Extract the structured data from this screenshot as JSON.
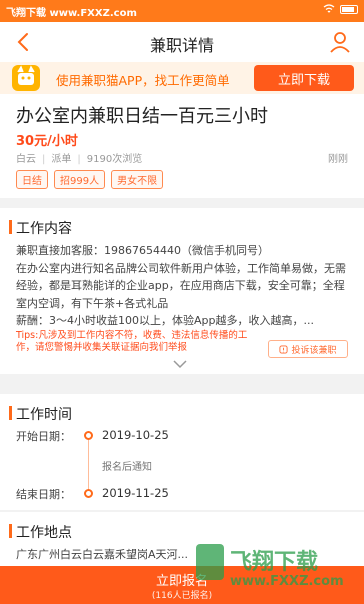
{
  "status": {
    "watermark": "飞翔下载 www.FXXZ.com",
    "battery_icon": "battery-icon"
  },
  "nav": {
    "title": "兼职详情",
    "back_icon": "back-arrow-icon",
    "user_icon": "user-icon"
  },
  "banner": {
    "text": "使用兼职猫APP，找工作更简单",
    "button": "立即下载"
  },
  "job": {
    "title": "办公室内兼职日结一百元三小时",
    "salary": "30元/小时",
    "district": "白云",
    "type": "派单",
    "views": "9190次浏览",
    "time": "刚刚",
    "tags": [
      "日结",
      "招999人",
      "男女不限"
    ]
  },
  "content": {
    "heading": "工作内容",
    "lines": [
      "兼职直接加客服：19867654440（微信手机同号）",
      "在办公室内进行知名品牌公司软件新用户体验，工作简单易做，无需经验，都是耳熟能详的企业app，在应用商店下载，安全可靠；全程室内空调，有下午茶+各式礼品",
      "薪酬：3～4小时收益100以上，体验App越多，收入越高，..."
    ],
    "tips": "Tips:凡涉及到工作内容不符，收费、违法信息传播的工作，请您警惕并收集关联证据向我们举报",
    "report_button": "投诉该兼职"
  },
  "schedule": {
    "heading": "工作时间",
    "start_label": "开始日期：",
    "start_value": "2019-10-25",
    "note": "报名后通知",
    "end_label": "结束日期：",
    "end_value": "2019-11-25"
  },
  "place": {
    "heading": "工作地点",
    "address": "广东广州白云白云嘉禾望岗A天河..."
  },
  "bottom": {
    "primary": "立即报名",
    "count": "(116人已报名)"
  },
  "watermark": {
    "cn": "飞翔下载",
    "en": "www.FXXZ.com"
  },
  "colors": {
    "accent": "#ff6a1a",
    "banner_bg": "#fff3e6",
    "salary": "#ff4a1a"
  }
}
